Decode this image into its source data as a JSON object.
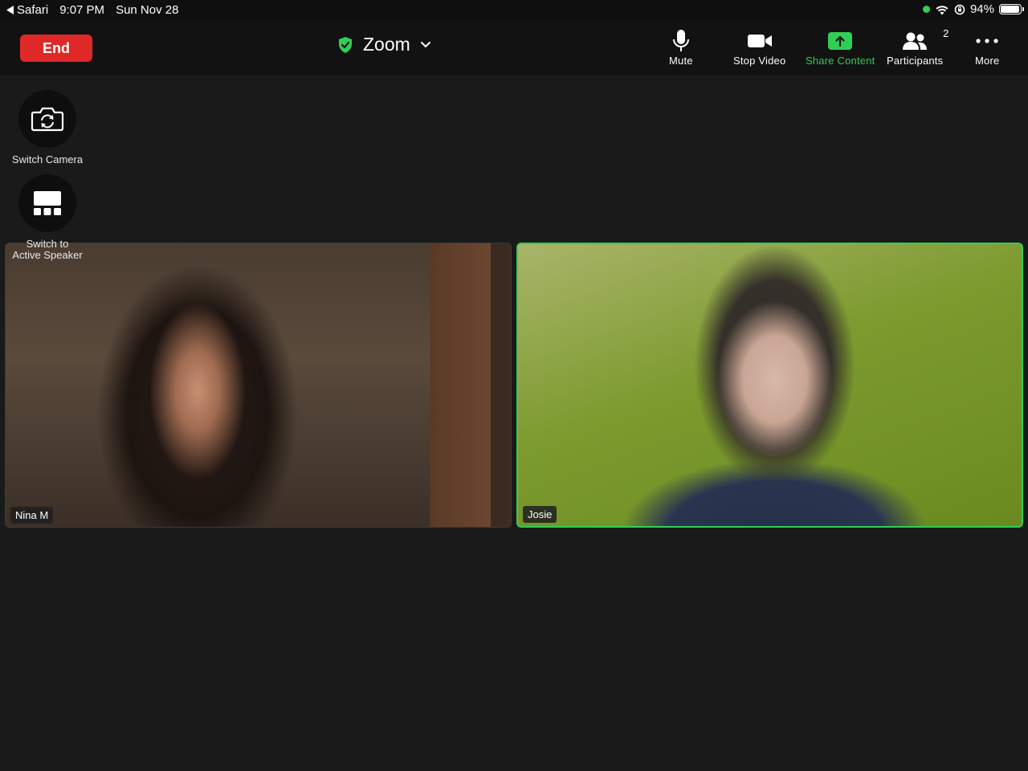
{
  "status_bar": {
    "back_app": "Safari",
    "time": "9:07 PM",
    "date": "Sun Nov 28",
    "battery_percent_label": "94%",
    "battery_level": 0.94,
    "camera_indicator_color": "#2fce55"
  },
  "toolbar": {
    "end_label": "End",
    "meeting_title": "Zoom",
    "shield_icon": "shield-check-icon",
    "items": {
      "mute": {
        "label": "Mute",
        "icon": "microphone-icon"
      },
      "stop_video": {
        "label": "Stop Video",
        "icon": "video-camera-icon"
      },
      "share_content": {
        "label": "Share Content",
        "icon": "share-up-arrow-icon"
      },
      "participants": {
        "label": "Participants",
        "count": "2",
        "icon": "people-icon"
      },
      "more": {
        "label": "More",
        "icon": "ellipsis-icon"
      }
    }
  },
  "side_controls": {
    "switch_camera": {
      "label": "Switch Camera",
      "icon": "camera-rotate-icon"
    },
    "switch_view": {
      "label_line1": "Switch to",
      "label_line2": "Active Speaker",
      "icon": "speaker-view-icon"
    }
  },
  "participants": [
    {
      "name": "Nina M",
      "active_speaker": false
    },
    {
      "name": "Josie",
      "active_speaker": true
    }
  ],
  "colors": {
    "accent_green": "#2fce55",
    "end_red": "#e02828",
    "background": "#1a1a1a"
  }
}
